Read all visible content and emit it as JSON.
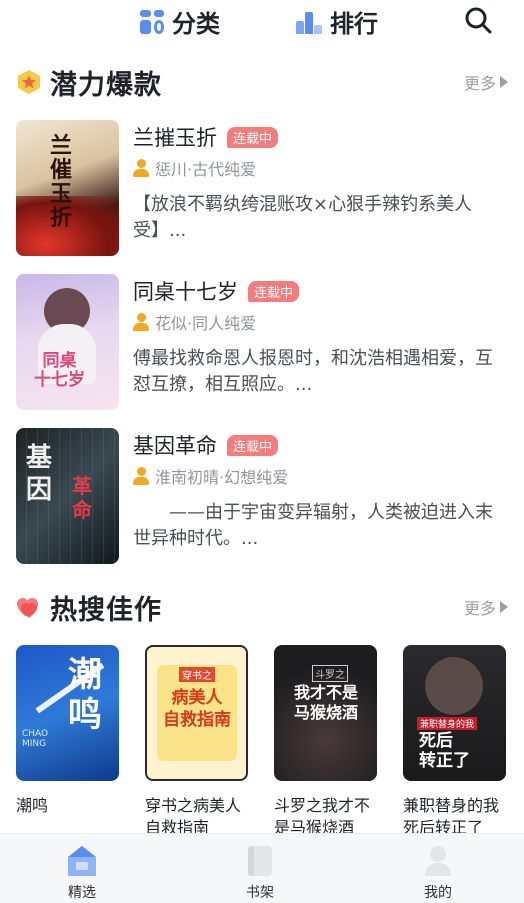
{
  "nav": {
    "category_label": "分类",
    "rank_label": "排行"
  },
  "sections": {
    "potential": {
      "title": "潜力爆款",
      "more": "更多"
    },
    "hot": {
      "title": "热搜佳作",
      "more": "更多"
    }
  },
  "books": [
    {
      "title": "兰摧玉折",
      "status": "连载中",
      "author": "惩川·古代纯爱",
      "desc": "【放浪不羁纨绔混账攻×心狠手辣钓系美人受】...",
      "cover_text": "兰\n催\n玉\n折"
    },
    {
      "title": "同桌十七岁",
      "status": "连载中",
      "author": "花似·同人纯爱",
      "desc": "傅最找救命恩人报恩时，和沈浩相遇相爱，互怼互撩，相互照应。...",
      "cover_text": "同桌\n十七岁"
    },
    {
      "title": "基因革命",
      "status": "连载中",
      "author": "淮南初晴·幻想纯爱",
      "desc": "　　——由于宇宙变异辐射，人类被迫进入末世异种时代。...",
      "cover_text": "基\n因",
      "cover_text_2": "革\n命"
    }
  ],
  "hot_books": [
    {
      "title": "潮鸣",
      "cover_text": "潮\n鸣",
      "cover_sub": "CHAO MING"
    },
    {
      "title": "穿书之病美人自救指南",
      "cover_text": "病美人\n自救指南",
      "cover_sub": "穿书之"
    },
    {
      "title": "斗罗之我才不是马猴烧酒",
      "cover_text": "我才不是\n马猴烧酒",
      "cover_sub": "斗罗之"
    },
    {
      "title": "兼职替身的我死后转正了",
      "cover_text": "死后\n转正了",
      "cover_sub": "兼职替身的我"
    }
  ],
  "tabs": [
    {
      "label": "精选",
      "active": true
    },
    {
      "label": "书架",
      "active": false
    },
    {
      "label": "我的",
      "active": false
    }
  ],
  "colors": {
    "accent_blue": "#5b8cf2",
    "status_red": "#f57c7c",
    "author_orange": "#f5a623",
    "more_gray": "#9a9ea6"
  }
}
